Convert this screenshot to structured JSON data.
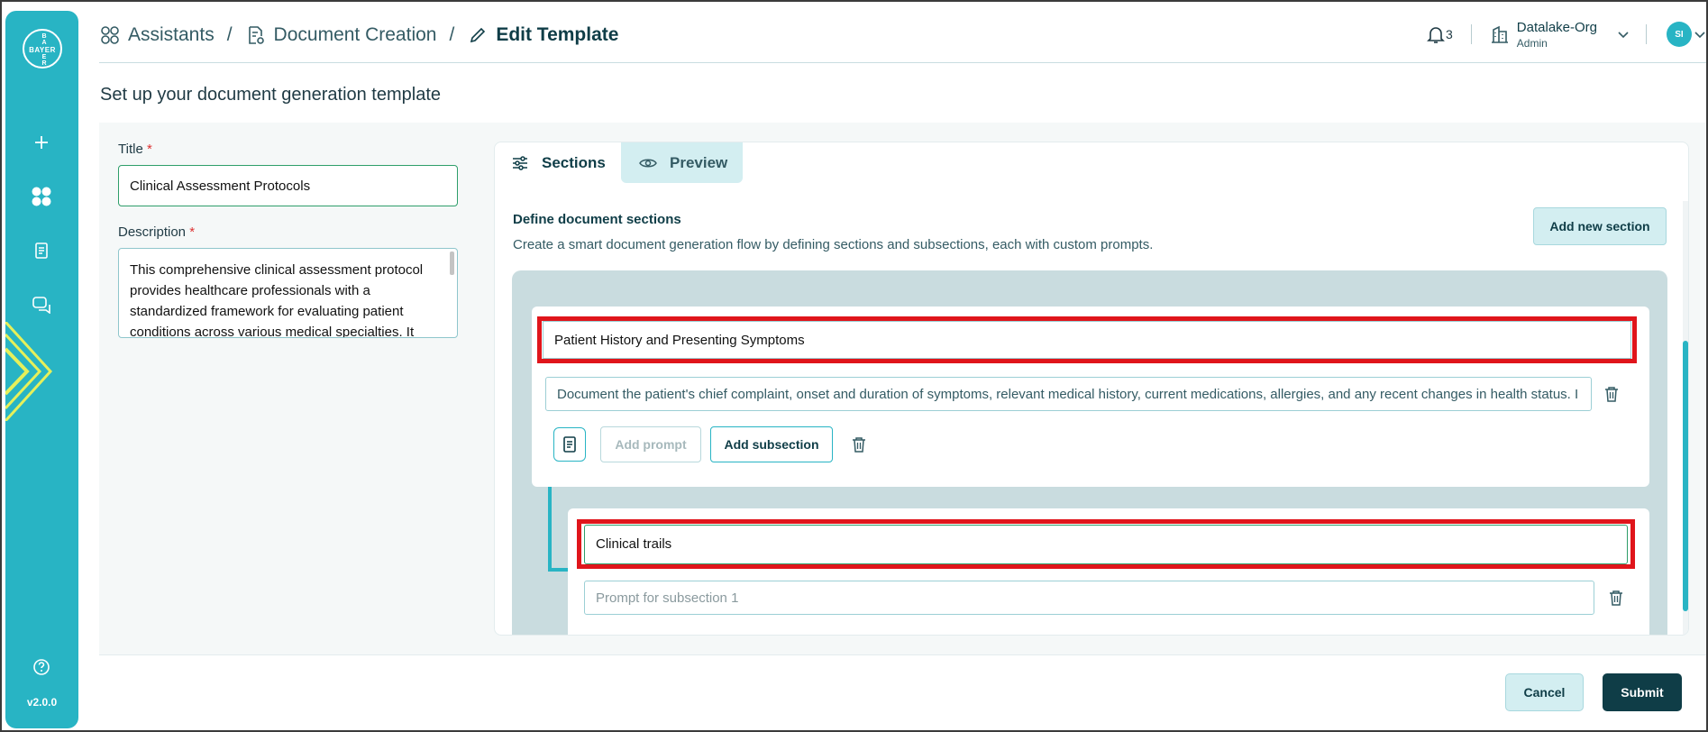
{
  "sidebar": {
    "logo_horizontal": "BAYER",
    "logo_vertical": [
      "B",
      "A",
      "Y",
      "E",
      "R"
    ],
    "version": "v2.0.0",
    "icons": [
      "plus-icon",
      "grid-icon",
      "document-icon",
      "chat-icon",
      "help-icon"
    ]
  },
  "header": {
    "breadcrumbs": [
      "Assistants",
      "Document Creation",
      "Edit Template"
    ],
    "separator": "/",
    "notifications_count": "3",
    "org_name": "Datalake-Org",
    "org_role": "Admin",
    "avatar_initials": "SI"
  },
  "page_title": "Set up your document generation template",
  "form": {
    "title_label": "Title",
    "title_value": "Clinical Assessment Protocols",
    "description_label": "Description",
    "required_mark": "*",
    "description_value": "This comprehensive clinical assessment protocol provides healthcare professionals with a standardized framework for evaluating patient conditions across various medical specialties. It"
  },
  "tabs": {
    "sections": "Sections",
    "preview": "Preview"
  },
  "sections_panel": {
    "title": "Define document sections",
    "subtitle": "Create a smart document generation flow by defining sections and subsections, each with custom prompts.",
    "add_section_label": "Add new section",
    "section": {
      "name": "Patient History and Presenting Symptoms",
      "prompt": "Document the patient's chief complaint, onset and duration of symptoms, relevant medical history, current medications, allergies, and any recent changes in health status. I",
      "add_prompt_label": "Add prompt",
      "add_subsection_label": "Add subsection",
      "subsection": {
        "name": "Clinical trails",
        "prompt_placeholder": "Prompt for subsection 1"
      }
    }
  },
  "footer": {
    "cancel_label": "Cancel",
    "submit_label": "Submit"
  },
  "colors": {
    "accent": "#28b4c4",
    "dark": "#0f3d47",
    "highlight": "#e0151b"
  }
}
